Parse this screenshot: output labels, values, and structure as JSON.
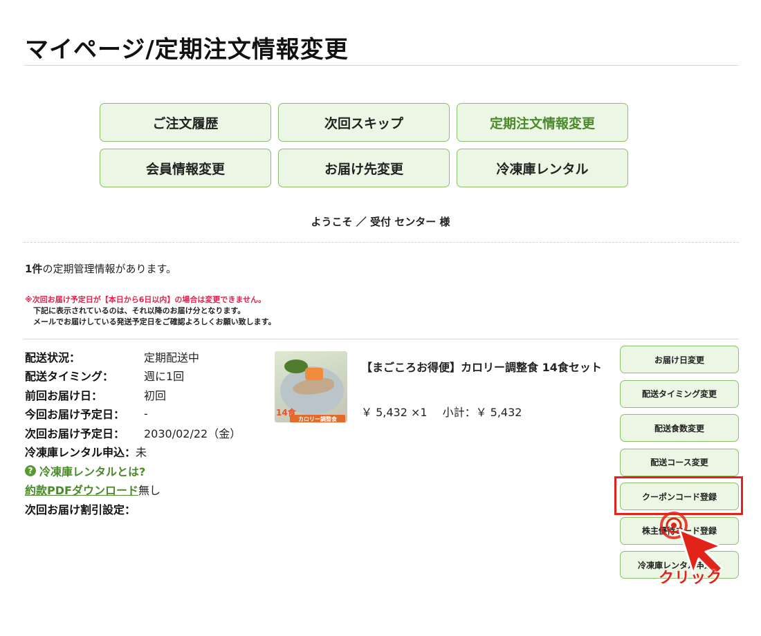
{
  "page": {
    "title": "マイページ/定期注文情報変更"
  },
  "nav": {
    "items": [
      {
        "label": "ご注文履歴"
      },
      {
        "label": "次回スキップ"
      },
      {
        "label": "定期注文情報変更"
      },
      {
        "label": "会員情報変更"
      },
      {
        "label": "お届け先変更"
      },
      {
        "label": "冷凍庫レンタル"
      }
    ],
    "active_index": 2
  },
  "welcome": "ようこそ ／ 受付 センター 様",
  "summary": {
    "count": "1件",
    "count_suffix": "の定期管理情報があります。"
  },
  "notes": {
    "warning": "※次回お届け予定日が【本日から6日以内】の場合は変更できません。",
    "line1": "下記に表示されているのは、それ以降のお届け分となります。",
    "line2": "メールでお届けしている発送予定日をご確認よろしくお願い致します。"
  },
  "info": {
    "rows": [
      {
        "label": "配送状況：",
        "value": "定期配送中"
      },
      {
        "label": "配送タイミング：",
        "value": "週に1回"
      },
      {
        "label": "前回お届け日：",
        "value": "初回"
      },
      {
        "label": "今回お届け予定日：",
        "value": "-"
      },
      {
        "label": "次回お届け予定日：",
        "value": "2030/02/22（金）"
      }
    ],
    "freezer_label": "冷凍庫レンタル申込：",
    "freezer_value": "未",
    "freezer_help": "冷凍庫レンタルとは?",
    "pdf_link": "約款PDFダウンロード",
    "pdf_suffix": "無し",
    "discount_label": "次回お届け割引設定："
  },
  "product": {
    "name": "【まごころお得便】カロリー調整食 14食セット",
    "price": "￥ 5,432 ×1",
    "subtotal": "小計：￥ 5,432",
    "image_badge_num": "14食",
    "image_badge_label": "カロリー調整食"
  },
  "actions": {
    "buttons": [
      {
        "label": "お届け日変更"
      },
      {
        "label": "配送タイミング変更"
      },
      {
        "label": "配送食数変更"
      },
      {
        "label": "配送コース変更"
      },
      {
        "label": "クーポンコード登録"
      },
      {
        "label": "株主優待コード登録"
      },
      {
        "label": "冷凍庫レンタル申込み"
      }
    ]
  },
  "annotation": {
    "click_label": "クリック",
    "highlight_color": "#e2231a"
  },
  "colors": {
    "accent_green": "#4a8a2a",
    "button_bg": "#ebf6e4",
    "button_border": "#8bbf6a",
    "warning": "#e0224a"
  }
}
